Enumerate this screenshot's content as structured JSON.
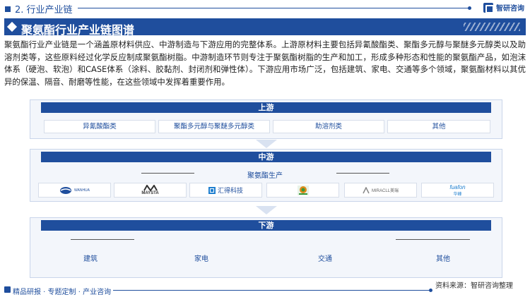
{
  "header": {
    "section_title": "2. 行业产业链",
    "brand_name": "智研咨询"
  },
  "title": "聚氨酯行业产业链图谱",
  "intro": "聚氨酯行业产业链是一个涵盖原材料供应、中游制造与下游应用的完整体系。上游原材料主要包括异氰酸酯类、聚酯多元醇与聚醚多元醇类以及助溶剂类等，这些原料经过化学反应制成聚氨酯树脂。中游制造环节则专注于聚氨酯树脂的生产和加工，形成多种形态和性能的聚氨酯产品，如泡沫体系（硬泡、软泡）和CASE体系（涂料、胶黏剂、封闭剂和弹性体）。下游应用市场广泛，包括建筑、家电、交通等多个领域，聚氨酯材料以其优异的保温、隔音、耐磨等性能，在这些领域中发挥着重要作用。",
  "chain": {
    "upstream": {
      "label": "上游",
      "items": [
        "异氰酸酯类",
        "聚酯多元醇与聚醚多元醇类",
        "助溶剂类",
        "其他"
      ]
    },
    "midstream": {
      "label": "中游",
      "sublabel": "聚氨酯生产",
      "companies": [
        "WANHUA",
        "MAYSTA",
        "汇得科技",
        "",
        "MIRACLL美瑞",
        "华峰"
      ]
    },
    "downstream": {
      "label": "下游",
      "items": [
        "建筑",
        "家电",
        "交通",
        "其他"
      ]
    }
  },
  "footer": {
    "source": "资料来源：智研咨询整理",
    "tagline": "精品研报 · 专题定制 · 产业咨询"
  },
  "colors": {
    "primary": "#1f4e9d",
    "panel_bg": "#f3f6fb"
  }
}
